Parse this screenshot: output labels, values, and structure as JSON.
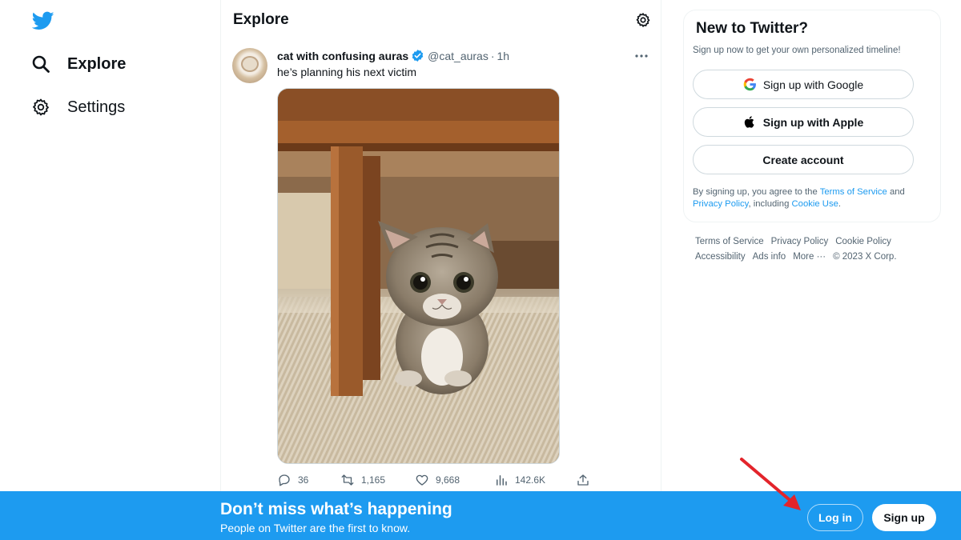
{
  "nav": {
    "logo_icon": "twitter-bird-icon",
    "items": [
      {
        "label": "Explore",
        "icon": "search-icon",
        "active": true
      },
      {
        "label": "Settings",
        "icon": "gear-icon",
        "active": false
      }
    ]
  },
  "main": {
    "title": "Explore",
    "settings_icon": "gear-icon"
  },
  "tweet": {
    "author_name": "cat with confusing auras",
    "verified": true,
    "handle": "@cat_auras",
    "separator": "·",
    "time": "1h",
    "text": "he’s planning his next victim",
    "media": "photo of a small tabby kitten sitting under a wooden table",
    "actions": {
      "replies": "36",
      "retweets": "1,165",
      "likes": "9,668",
      "views": "142.6K"
    }
  },
  "signup_card": {
    "title": "New to Twitter?",
    "subtitle": "Sign up now to get your own personalized timeline!",
    "google_button": "Sign up with Google",
    "apple_button": "Sign up with Apple",
    "create_button": "Create account",
    "legal_prefix": "By signing up, you agree to the ",
    "terms_link": "Terms of Service",
    "legal_and": " and ",
    "privacy_link": "Privacy Policy",
    "legal_including": ", including ",
    "cookie_link": "Cookie Use",
    "legal_end": "."
  },
  "footer": {
    "terms": "Terms of Service",
    "privacy": "Privacy Policy",
    "cookie": "Cookie Policy",
    "accessibility": "Accessibility",
    "ads": "Ads info",
    "more": "More ···",
    "copyright": "© 2023 X Corp."
  },
  "banner": {
    "title": "Don’t miss what’s happening",
    "subtitle": "People on Twitter are the first to know.",
    "login_label": "Log in",
    "signup_label": "Sign up"
  },
  "colors": {
    "brand_blue": "#1d9bf0",
    "text_primary": "#0f1419",
    "text_secondary": "#536471",
    "annotation_red": "#e3242b"
  }
}
